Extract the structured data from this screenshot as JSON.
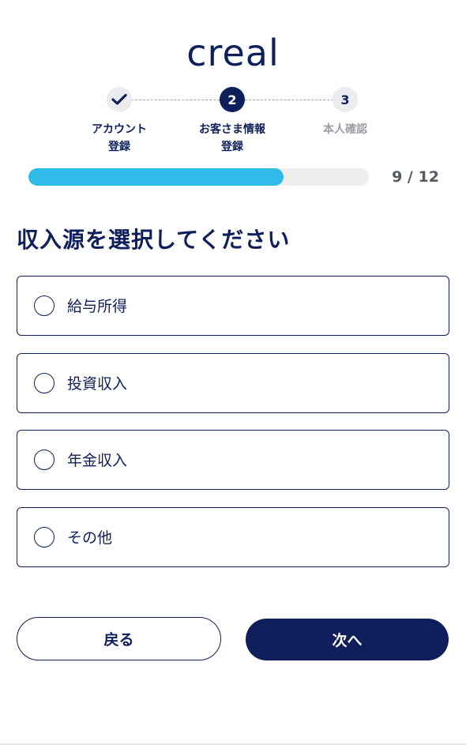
{
  "brand": {
    "logo_text": "creal"
  },
  "stepper": {
    "steps": [
      {
        "number": "1",
        "label_line1": "アカウント",
        "label_line2": "登録",
        "state": "completed",
        "icon": "check-icon"
      },
      {
        "number": "2",
        "label_line1": "お客さま情報",
        "label_line2": "登録",
        "state": "current"
      },
      {
        "number": "3",
        "label_line1": "本人確認",
        "label_line2": "",
        "state": "upcoming"
      }
    ]
  },
  "progress": {
    "current": 9,
    "total": 12,
    "label": "9 / 12",
    "fraction": 0.75
  },
  "question": {
    "title": "収入源を選択してください"
  },
  "options": [
    {
      "label": "給与所得",
      "selected": false
    },
    {
      "label": "投資収入",
      "selected": false
    },
    {
      "label": "年金収入",
      "selected": false
    },
    {
      "label": "その他",
      "selected": false
    }
  ],
  "actions": {
    "back_label": "戻る",
    "next_label": "次へ"
  },
  "colors": {
    "navy": "#0f1f5c",
    "progress_fill": "#2ebbe8",
    "progress_track": "#eeeeee",
    "muted_text": "#9b9ea6"
  }
}
